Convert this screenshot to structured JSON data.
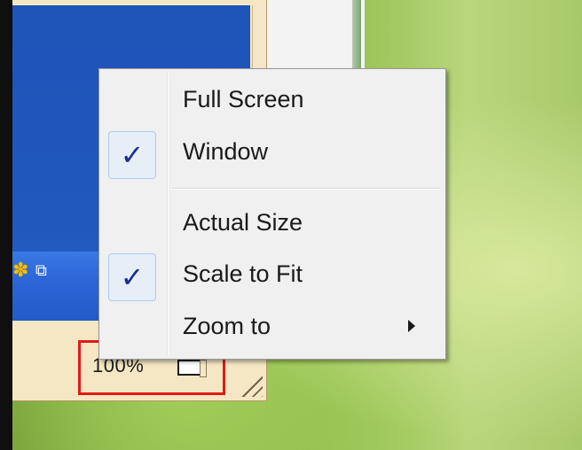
{
  "context_menu": {
    "items": [
      {
        "label": "Full Screen",
        "checked": false
      },
      {
        "label": "Window",
        "checked": true
      },
      {
        "label": "Actual Size",
        "checked": false
      },
      {
        "label": "Scale to Fit",
        "checked": true
      },
      {
        "label": "Zoom to",
        "has_submenu": true
      }
    ],
    "check_glyph": "✓"
  },
  "status_bar": {
    "zoom_level": "100%"
  },
  "icons": {
    "tray_1": "flower-icon",
    "tray_2": "network-icon",
    "check": "checkmark-icon",
    "submenu": "chevron-right-icon",
    "screen": "screen-size-icon",
    "grip": "resize-grip-icon"
  },
  "colors": {
    "highlight": "#e11a1a",
    "menu_bg": "#f0f0f0",
    "check_color": "#1b2d8f",
    "desktop_green": "#8fbe4b",
    "vm_blue": "#2058be"
  }
}
